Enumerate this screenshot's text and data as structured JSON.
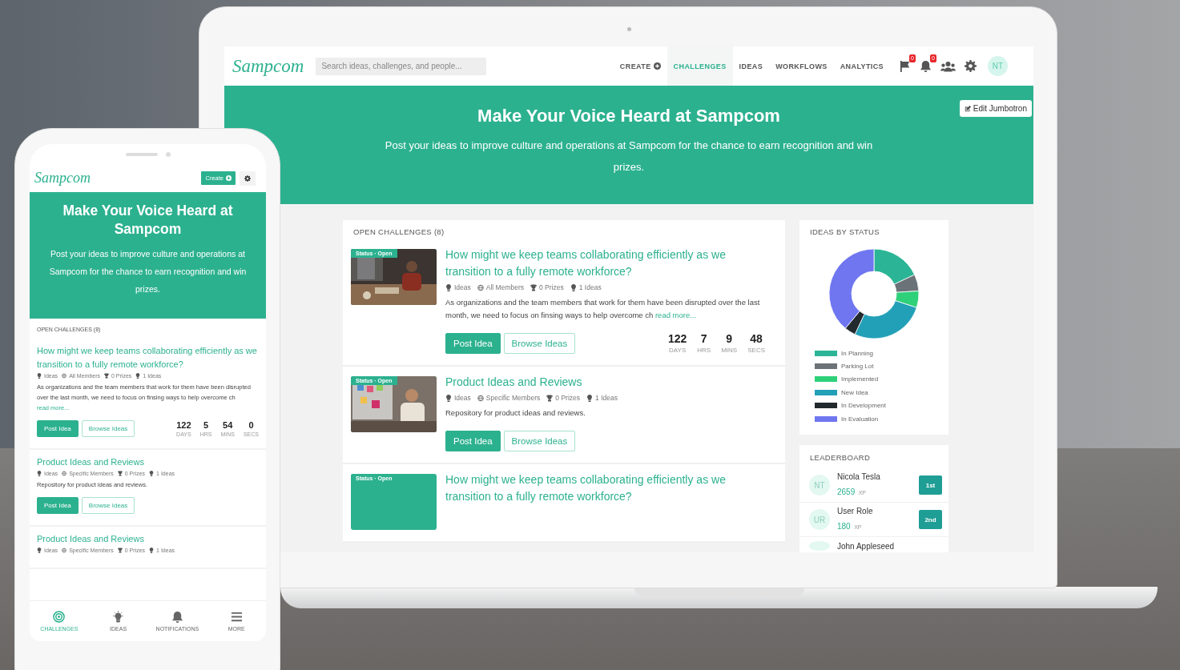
{
  "laptop": {
    "nav": {
      "logo": "Sampcom",
      "search_placeholder": "Search ideas, challenges, and people...",
      "items": [
        {
          "label": "CREATE",
          "kind": "create",
          "selected": false
        },
        {
          "label": "CHALLENGES",
          "kind": "link",
          "selected": true
        },
        {
          "label": "IDEAS",
          "kind": "link",
          "selected": false
        },
        {
          "label": "WORKFLOWS",
          "kind": "link",
          "selected": false
        },
        {
          "label": "ANALYTICS",
          "kind": "link",
          "selected": false
        }
      ],
      "icons": [
        {
          "kind": "flag",
          "badge": "0"
        },
        {
          "kind": "bell",
          "badge": "0"
        },
        {
          "kind": "people"
        },
        {
          "kind": "settings"
        }
      ],
      "avatar": "NT"
    },
    "jumbotron": {
      "title": "Make Your Voice Heard at Sampcom",
      "text": "Post your ideas to improve culture and operations at Sampcom for the chance to earn recognition and win prizes.",
      "edit_button": "Edit Jumbotron"
    },
    "challenges": {
      "heading": "OPEN CHALLENGES (8)",
      "items": [
        {
          "thumbnail": {
            "kind": "picture"
          },
          "status": "Status · Open",
          "title": "How might we keep teams collaborating efficiently as we transition to a fully remote workforce?",
          "meta": [
            {
              "kind": "bulb",
              "text": "Ideas"
            },
            {
              "kind": "globe",
              "text": "All Members"
            },
            {
              "kind": "trophy",
              "text": "0 Prizes"
            },
            {
              "kind": "bulb",
              "text": "1 Ideas"
            }
          ],
          "description": "As organizations and the team members that work for them have been disrupted over the last month, we need to focus on finsing ways to help overcome ch",
          "read_more": "read more...",
          "buttons": [
            {
              "label": "Post Idea",
              "kind": "primary"
            },
            {
              "label": "Browse Ideas",
              "kind": "outline"
            }
          ],
          "countdown": [
            {
              "value": "122",
              "unit": "DAYS"
            },
            {
              "value": "7",
              "unit": "HRS"
            },
            {
              "value": "9",
              "unit": "MINS"
            },
            {
              "value": "48",
              "unit": "SECS"
            }
          ]
        },
        {
          "thumbnail": {
            "kind": "picture"
          },
          "status": "Status · Open",
          "title": "Product Ideas and Reviews",
          "meta": [
            {
              "kind": "bulb",
              "text": "Ideas"
            },
            {
              "kind": "globe",
              "text": "Specific Members"
            },
            {
              "kind": "trophy",
              "text": "0 Prizes"
            },
            {
              "kind": "bulb",
              "text": "1 Ideas"
            }
          ],
          "description": "Repository for product ideas and reviews.",
          "buttons": [
            {
              "label": "Post Idea",
              "kind": "primary"
            },
            {
              "label": "Browse Ideas",
              "kind": "outline"
            }
          ]
        },
        {
          "thumbnail": {
            "kind": "plain"
          },
          "status": "Status · Open",
          "title": "How might we keep teams collaborating efficiently as we transition to a fully remote workforce?"
        }
      ]
    },
    "ideas_by_status": {
      "heading": "IDEAS BY STATUS",
      "legend": [
        {
          "label": "In Planning",
          "color": "#2bb596"
        },
        {
          "label": "Parking Lot",
          "color": "#6b7278"
        },
        {
          "label": "Implemented",
          "color": "#2fd07a"
        },
        {
          "label": "New Idea",
          "color": "#22a0b8"
        },
        {
          "label": "In Development",
          "color": "#222a2e"
        },
        {
          "label": "In Evaluation",
          "color": "#6f76f0"
        }
      ]
    },
    "leaderboard": {
      "heading": "LEADERBOARD",
      "entries": [
        {
          "initials": "NT",
          "name": "Nicola Tesla",
          "xp": "2659",
          "xp_unit": "XP",
          "rank": "1st"
        },
        {
          "initials": "UR",
          "name": "User Role",
          "xp": "180",
          "xp_unit": "XP",
          "rank": "2nd"
        },
        {
          "name": "John Appleseed"
        }
      ]
    }
  },
  "phone": {
    "logo": "Sampcom",
    "create_button": "Create",
    "jumbotron": {
      "title": "Make Your Voice Heard at Sampcom",
      "text": "Post your ideas to improve culture and operations at Sampcom for the chance to earn recognition and win prizes."
    },
    "challenges": {
      "heading": "OPEN CHALLENGES (8)",
      "items": [
        {
          "title": "How might we keep teams collaborating efficiently as we transition to a fully remote workforce?",
          "meta": [
            {
              "kind": "bulb",
              "text": "Ideas"
            },
            {
              "kind": "globe",
              "text": "All Members"
            },
            {
              "kind": "trophy",
              "text": "0 Prizes"
            },
            {
              "kind": "bulb",
              "text": "1 Ideas"
            }
          ],
          "description": "As organizations and the team members that work for them have been disrupted over the last month, we need to focus on finsing ways to help overcome ch",
          "read_more": "read more...",
          "buttons": [
            {
              "label": "Post Idea",
              "kind": "primary"
            },
            {
              "label": "Browse Ideas",
              "kind": "outline"
            }
          ],
          "countdown": [
            {
              "value": "122",
              "unit": "DAYS"
            },
            {
              "value": "5",
              "unit": "HRS"
            },
            {
              "value": "54",
              "unit": "MINS"
            },
            {
              "value": "0",
              "unit": "SECS"
            }
          ]
        },
        {
          "title": "Product Ideas and Reviews",
          "meta": [
            {
              "kind": "bulb",
              "text": "Ideas"
            },
            {
              "kind": "globe",
              "text": "Specific Members"
            },
            {
              "kind": "trophy",
              "text": "0 Prizes"
            },
            {
              "kind": "bulb",
              "text": "1 Ideas"
            }
          ],
          "description": "Repository for product ideas and reviews.",
          "buttons": [
            {
              "label": "Post Idea",
              "kind": "primary"
            },
            {
              "label": "Browse Ideas",
              "kind": "outline"
            }
          ]
        },
        {
          "title": "Product Ideas and Reviews",
          "meta": [
            {
              "kind": "bulb",
              "text": "Ideas"
            },
            {
              "kind": "globe",
              "text": "Specific Members"
            },
            {
              "kind": "trophy",
              "text": "0 Prizes"
            },
            {
              "kind": "bulb",
              "text": "1 Ideas"
            }
          ]
        }
      ]
    },
    "tabs": [
      {
        "label": "CHALLENGES",
        "kind": "target",
        "selected": true
      },
      {
        "label": "IDEAS",
        "kind": "bulb",
        "selected": false
      },
      {
        "label": "NOTIFICATIONS",
        "kind": "bell",
        "selected": false
      },
      {
        "label": "MORE",
        "kind": "menu",
        "selected": false
      }
    ]
  }
}
